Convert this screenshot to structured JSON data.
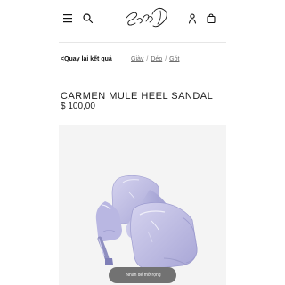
{
  "header": {
    "logo_text": "Sam Edelman",
    "icons": {
      "menu": "menu-icon",
      "search": "search-icon",
      "account": "account-icon",
      "bag": "bag-icon"
    }
  },
  "breadcrumb": {
    "back_label": "<Quay lại kết quả",
    "items": [
      {
        "label": "Giày"
      },
      {
        "label": "Dép"
      },
      {
        "label": "Gót"
      }
    ]
  },
  "product": {
    "title": "CARMEN MULE HEEL SANDAL",
    "price": "$ 100,00",
    "zoom_hint": "Nhấn để mở rộng",
    "image_name": "lavender mule heel sandal"
  },
  "colors": {
    "text": "#1f1f1f",
    "muted": "#6b6b6b",
    "pill": "#727272",
    "sandal": "#b7b5df",
    "shadow": "#8f8fc0"
  }
}
